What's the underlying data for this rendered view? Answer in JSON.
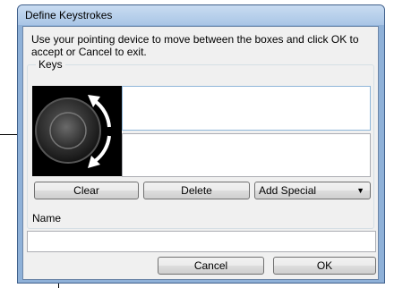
{
  "window": {
    "title": "Define Keystrokes"
  },
  "instructions": "Use your pointing device to move between the boxes and click OK to accept or Cancel to exit.",
  "keys": {
    "label": "Keys",
    "image_icon": "touch-ring-icon",
    "fields": [
      {
        "value": ""
      },
      {
        "value": ""
      }
    ]
  },
  "buttons": {
    "clear": "Clear",
    "delete": "Delete",
    "add_special": "Add Special",
    "cancel": "Cancel",
    "ok": "OK"
  },
  "name": {
    "label": "Name",
    "value": ""
  }
}
